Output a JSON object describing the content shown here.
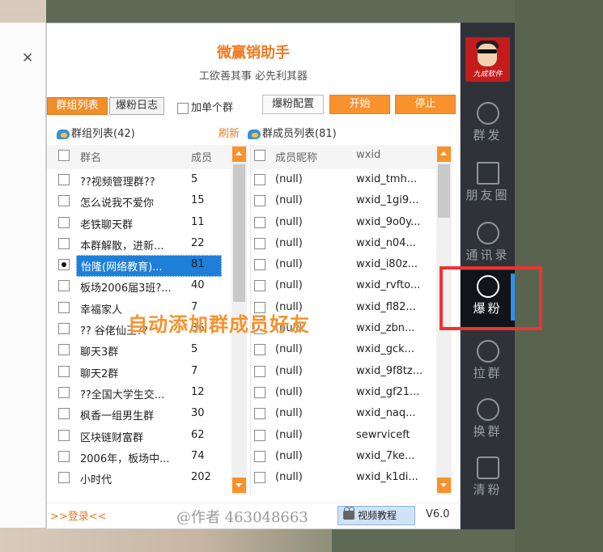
{
  "app": {
    "title": "微赢销助手",
    "subtitle": "工欲善其事 必先利其器"
  },
  "tabs": {
    "groups_tab": "群组列表",
    "log_tab": "爆粉日志",
    "single_group": "加单个群",
    "config_button": "爆粉配置",
    "start_button": "开始",
    "stop_button": "停止"
  },
  "sections": {
    "groups_header": "群组列表(42)",
    "refresh": "刷新",
    "members_header": "群成员列表(81)"
  },
  "groups": {
    "col_name": "群名",
    "col_count": "成员",
    "rows": [
      {
        "name": "??视频管理群??",
        "count": "5"
      },
      {
        "name": "怎么说我不爱你",
        "count": "15"
      },
      {
        "name": "老铁聊天群",
        "count": "11"
      },
      {
        "name": "本群解散，进新...",
        "count": "22"
      },
      {
        "name": "怡隆(网络教育)...",
        "count": "81"
      },
      {
        "name": "板场2006届3班?...",
        "count": "40"
      },
      {
        "name": "幸福家人",
        "count": "7"
      },
      {
        "name": "?? 谷佬仙王??",
        "count": "36"
      },
      {
        "name": "聊天3群",
        "count": "5"
      },
      {
        "name": "聊天2群",
        "count": "7"
      },
      {
        "name": "??全国大学生交...",
        "count": "12"
      },
      {
        "name": "枫香一组男生群",
        "count": "30"
      },
      {
        "name": "区块链财富群",
        "count": "62"
      },
      {
        "name": "2006年，板场中...",
        "count": "74"
      },
      {
        "name": "小时代",
        "count": "202"
      }
    ]
  },
  "members": {
    "col_nick": "成员昵称",
    "col_wxid": "wxid",
    "rows": [
      {
        "nick": "(null)",
        "wxid": "wxid_tmh..."
      },
      {
        "nick": "(null)",
        "wxid": "wxid_1gi9..."
      },
      {
        "nick": "(null)",
        "wxid": "wxid_9o0y..."
      },
      {
        "nick": "(null)",
        "wxid": "wxid_n04..."
      },
      {
        "nick": "(null)",
        "wxid": "wxid_i80z..."
      },
      {
        "nick": "(null)",
        "wxid": "wxid_rvfto..."
      },
      {
        "nick": "(null)",
        "wxid": "wxid_fl82..."
      },
      {
        "nick": "(null)",
        "wxid": "wxid_zbn..."
      },
      {
        "nick": "(null)",
        "wxid": "wxid_gck..."
      },
      {
        "nick": "(null)",
        "wxid": "wxid_9f8tz..."
      },
      {
        "nick": "(null)",
        "wxid": "wxid_gf21..."
      },
      {
        "nick": "(null)",
        "wxid": "wxid_naq..."
      },
      {
        "nick": "(null)",
        "wxid": "sewrviceft"
      },
      {
        "nick": "(null)",
        "wxid": "wxid_7ke..."
      },
      {
        "nick": "(null)",
        "wxid": "wxid_k1di..."
      }
    ]
  },
  "overlay": "自动添加群成员好友",
  "footer": {
    "login": ">>登录<<",
    "author": "@作者 463048663",
    "video_button": "视频教程",
    "version": "V6.0"
  },
  "sidebar": {
    "avatar_caption": "九成软件",
    "items": [
      {
        "label": "群发",
        "icon": "broadcast-icon"
      },
      {
        "label": "朋友圈",
        "icon": "moments-icon"
      },
      {
        "label": "通讯录",
        "icon": "contacts-icon"
      },
      {
        "label": "爆粉",
        "icon": "add-friend-icon"
      },
      {
        "label": "拉群",
        "icon": "pull-group-icon"
      },
      {
        "label": "换群",
        "icon": "switch-group-icon"
      },
      {
        "label": "清粉",
        "icon": "clean-fans-icon"
      }
    ]
  },
  "colors": {
    "accent": "#f7922c",
    "selection": "#1e7fd8",
    "sidebar": "#2f3339",
    "highlight": "#ee3333"
  }
}
